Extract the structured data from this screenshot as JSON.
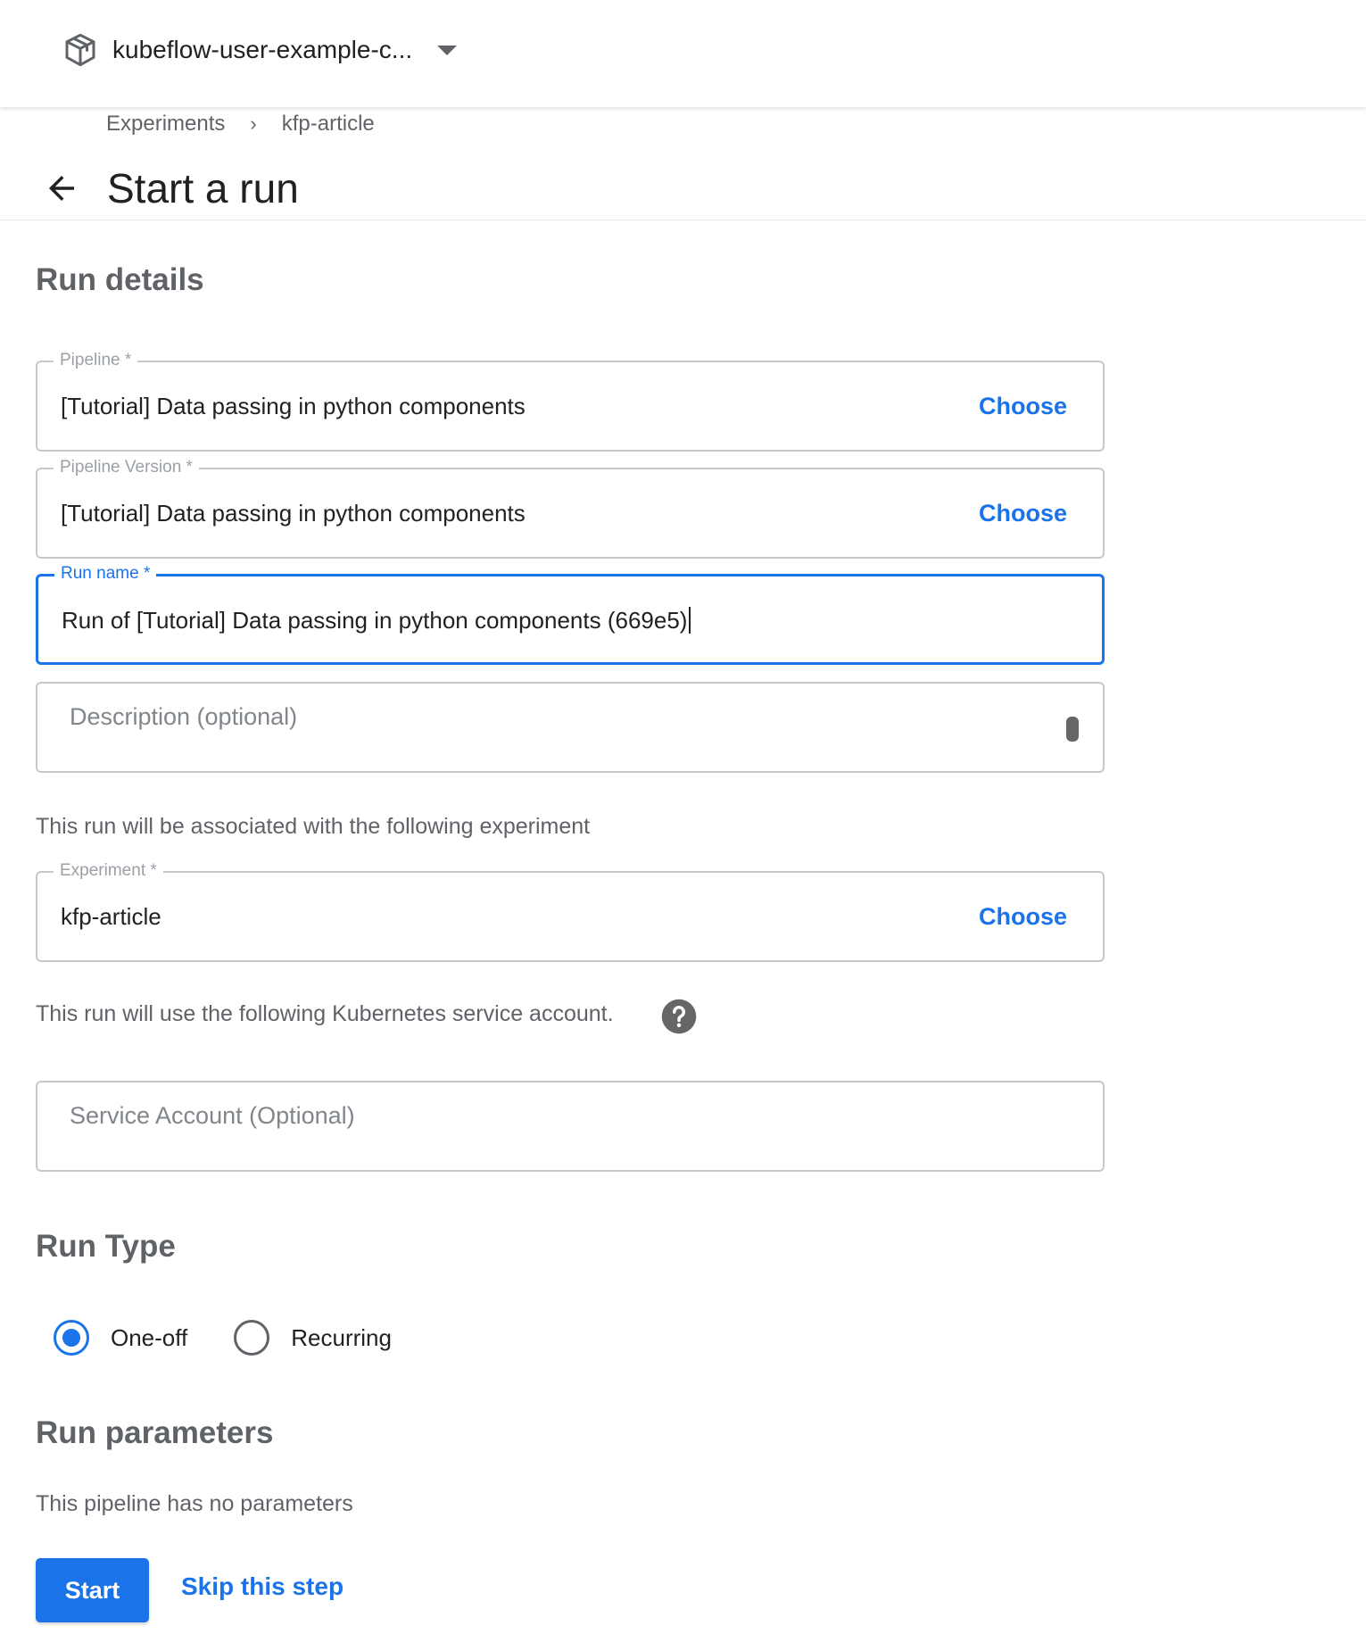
{
  "topbar": {
    "namespace": "kubeflow-user-example-c...",
    "namespace_icon": "package-icon",
    "dropdown_icon": "arrow-drop-down-icon"
  },
  "breadcrumb": {
    "items": [
      "Experiments",
      "kfp-article"
    ],
    "separator": "›"
  },
  "header": {
    "title": "Start a run",
    "back_icon": "arrow-back-icon"
  },
  "run_details": {
    "heading": "Run details",
    "pipeline": {
      "label": "Pipeline *",
      "value": "[Tutorial] Data passing in python components",
      "action": "Choose"
    },
    "pipeline_version": {
      "label": "Pipeline Version *",
      "value": "[Tutorial] Data passing in python components",
      "action": "Choose"
    },
    "run_name": {
      "label": "Run name *",
      "value": "Run of [Tutorial] Data passing in python components (669e5)"
    },
    "description": {
      "placeholder": "Description (optional)",
      "value": ""
    },
    "experiment_note": "This run will be associated with the following experiment",
    "experiment": {
      "label": "Experiment *",
      "value": "kfp-article",
      "action": "Choose"
    },
    "service_account_note": "This run will use the following Kubernetes service account.",
    "help_icon": "help-icon",
    "service_account": {
      "placeholder": "Service Account (Optional)",
      "value": ""
    }
  },
  "run_type": {
    "heading": "Run Type",
    "options": [
      {
        "label": "One-off",
        "selected": true
      },
      {
        "label": "Recurring",
        "selected": false
      }
    ]
  },
  "run_parameters": {
    "heading": "Run parameters",
    "note": "This pipeline has no parameters"
  },
  "actions": {
    "start": "Start",
    "skip": "Skip this step"
  },
  "colors": {
    "accent": "#1a73e8",
    "muted_text": "#5f6368",
    "border": "#c8c8c8"
  }
}
